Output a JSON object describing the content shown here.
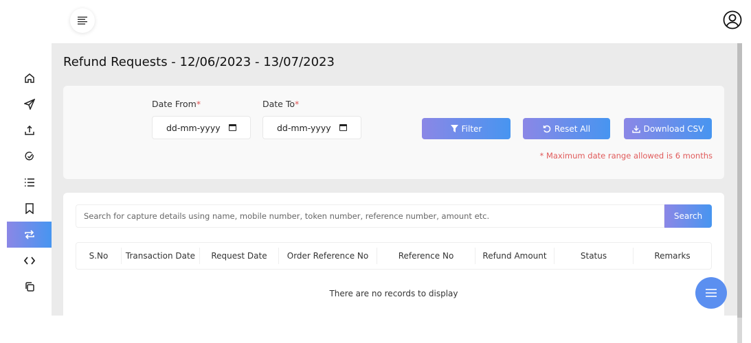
{
  "header": {
    "menu_icon": "menu-lines-icon",
    "user_icon": "user-circle-icon"
  },
  "sidebar": {
    "items": [
      {
        "icon": "home-icon"
      },
      {
        "icon": "send-icon"
      },
      {
        "icon": "upload-icon"
      },
      {
        "icon": "check-circle-icon"
      },
      {
        "icon": "list-icon"
      },
      {
        "icon": "bookmark-icon"
      },
      {
        "icon": "refund-arrows-icon",
        "active": true
      },
      {
        "icon": "code-icon"
      },
      {
        "icon": "copy-icon"
      }
    ]
  },
  "page": {
    "title": "Refund Requests - 12/06/2023 - 13/07/2023"
  },
  "filters": {
    "date_from_label": "Date From",
    "date_to_label": "Date To",
    "required_mark": "*",
    "date_from_value": "dd-mm-yyyy",
    "date_to_value": "dd-mm-yyyy",
    "filter_label": "Filter",
    "reset_label": "Reset All",
    "download_label": "Download CSV",
    "note": "* Maximum date range allowed is 6 months"
  },
  "search": {
    "placeholder": "Search for capture details using name, mobile number, token number, reference number, amount etc.",
    "button": "Search"
  },
  "table": {
    "columns": [
      "S.No",
      "Transaction Date",
      "Request Date",
      "Order Reference No",
      "Reference No",
      "Refund Amount",
      "Status",
      "Remarks"
    ],
    "empty": "There are no records to display"
  },
  "colors": {
    "accent_start": "#8b87e6",
    "accent_end": "#4795f0",
    "error": "#e05a5a"
  }
}
